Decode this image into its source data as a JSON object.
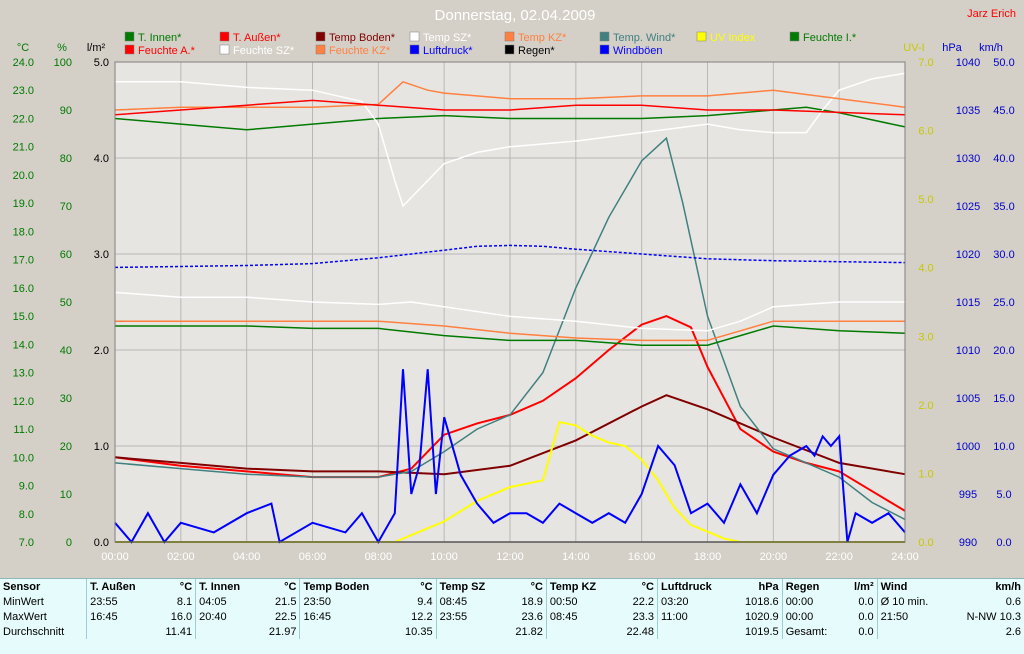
{
  "title": "Donnerstag, 02.04.2009",
  "author": "Jarz Erich",
  "colors": {
    "bg": "#d4d0c8",
    "plot": "#ffffff",
    "grid": "#c8c8c8",
    "green": "#007a00",
    "red": "#ff0000",
    "darkred": "#800000",
    "white": "#ffffff",
    "orange": "#ff8040",
    "blue": "#0000ff",
    "teal": "#408080",
    "yellow": "#ffff00",
    "black": "#000000",
    "rightblue": "#0000cc"
  },
  "legend": [
    {
      "label": "T. Innen*",
      "color": "#007a00"
    },
    {
      "label": "T. Außen*",
      "color": "#ff0000"
    },
    {
      "label": "Temp Boden*",
      "color": "#800000"
    },
    {
      "label": "Temp SZ*",
      "color": "#ffffff"
    },
    {
      "label": "Temp KZ*",
      "color": "#ff8040"
    },
    {
      "label": "Temp. Wind*",
      "color": "#408080"
    },
    {
      "label": "UV Index",
      "color": "#ffff00"
    },
    {
      "label": "Feuchte I.*",
      "color": "#007a00"
    },
    {
      "label": "Feuchte A.*",
      "color": "#ff0000"
    },
    {
      "label": "Feuchte SZ*",
      "color": "#ffffff"
    },
    {
      "label": "Feuchte KZ*",
      "color": "#ff8040"
    },
    {
      "label": "Luftdruck*",
      "color": "#0000ff"
    },
    {
      "label": "Regen*",
      "color": "#000000"
    },
    {
      "label": "Windböen",
      "color": "#0000ff"
    }
  ],
  "axes": {
    "temp": {
      "unit": "°C",
      "min": 7.0,
      "max": 24.0,
      "ticks": [
        "24.0",
        "23.0",
        "22.0",
        "21.0",
        "20.0",
        "19.0",
        "18.0",
        "17.0",
        "16.0",
        "15.0",
        "14.0",
        "13.0",
        "12.0",
        "11.0",
        "10.0",
        "9.0",
        "8.0",
        "7.0"
      ]
    },
    "hum": {
      "unit": "%",
      "min": 0,
      "max": 100,
      "ticks": [
        "100",
        "90",
        "80",
        "70",
        "60",
        "50",
        "40",
        "30",
        "20",
        "10",
        "0"
      ]
    },
    "rain": {
      "unit": "l/m²",
      "min": 0,
      "max": 5,
      "ticks": [
        "5.0",
        "4.0",
        "3.0",
        "2.0",
        "1.0",
        "0.0"
      ]
    },
    "uv": {
      "unit": "UV-I",
      "min": 0,
      "max": 7,
      "ticks": [
        "7.0",
        "6.0",
        "5.0",
        "4.0",
        "3.0",
        "2.0",
        "1.0",
        "0.0"
      ]
    },
    "press": {
      "unit": "hPa",
      "min": 990,
      "max": 1040,
      "ticks": [
        "1040",
        "1035",
        "1030",
        "1025",
        "1020",
        "1015",
        "1010",
        "1005",
        "1000",
        "995",
        "990"
      ]
    },
    "wind": {
      "unit": "km/h",
      "min": 0,
      "max": 50,
      "ticks": [
        "50.0",
        "45.0",
        "40.0",
        "35.0",
        "30.0",
        "25.0",
        "20.0",
        "15.0",
        "10.0",
        "5.0",
        "0.0"
      ]
    },
    "time": {
      "ticks": [
        "00:00",
        "02:00",
        "04:00",
        "06:00",
        "08:00",
        "10:00",
        "12:00",
        "14:00",
        "16:00",
        "18:00",
        "20:00",
        "22:00",
        "24:00"
      ]
    }
  },
  "chart_data": {
    "type": "line",
    "title": "Donnerstag, 02.04.2009",
    "x_unit": "hours",
    "series": [
      {
        "name": "T. Innen*",
        "color": "#007a00",
        "axis": "temp",
        "x": [
          0,
          2,
          4,
          6,
          8,
          10,
          12,
          14,
          16,
          18,
          20,
          21,
          22,
          24
        ],
        "y": [
          22.0,
          21.8,
          21.6,
          21.8,
          22.0,
          22.1,
          22.0,
          22.0,
          22.0,
          22.1,
          22.3,
          22.4,
          22.2,
          21.7
        ]
      },
      {
        "name": "T. Außen*",
        "color": "#ff0000",
        "axis": "temp",
        "x": [
          0,
          2,
          4,
          6,
          8,
          9,
          10,
          11,
          12,
          13,
          14,
          15,
          16,
          16.75,
          17.5,
          18,
          19,
          20,
          21,
          22,
          23,
          24
        ],
        "y": [
          10.0,
          9.7,
          9.5,
          9.3,
          9.3,
          9.6,
          10.8,
          11.2,
          11.5,
          12.0,
          12.8,
          13.8,
          14.7,
          15.0,
          14.6,
          13.2,
          11.0,
          10.2,
          9.8,
          9.5,
          8.8,
          8.1
        ]
      },
      {
        "name": "Temp Boden*",
        "color": "#800000",
        "axis": "temp",
        "x": [
          0,
          2,
          4,
          6,
          8,
          10,
          12,
          14,
          16,
          16.75,
          18,
          20,
          22,
          24
        ],
        "y": [
          10.0,
          9.8,
          9.6,
          9.5,
          9.5,
          9.4,
          9.7,
          10.6,
          11.8,
          12.2,
          11.7,
          10.7,
          9.8,
          9.4
        ]
      },
      {
        "name": "Temp SZ*",
        "color": "#ffffff",
        "axis": "temp",
        "x": [
          0,
          2,
          4,
          6,
          7.5,
          8,
          8.5,
          8.75,
          9.5,
          10,
          11,
          12,
          14,
          16,
          18,
          19,
          20,
          21,
          21.5,
          22,
          23,
          24
        ],
        "y": [
          23.3,
          23.3,
          23.1,
          23.0,
          22.6,
          21.8,
          19.8,
          18.9,
          19.8,
          20.4,
          20.8,
          21.0,
          21.2,
          21.5,
          21.8,
          21.6,
          21.5,
          21.5,
          22.3,
          23.0,
          23.4,
          23.6
        ]
      },
      {
        "name": "Temp KZ*",
        "color": "#ff8040",
        "axis": "temp",
        "x": [
          0,
          2,
          4,
          6,
          8,
          8.75,
          9.5,
          10,
          12,
          14,
          16,
          18,
          20,
          22,
          24
        ],
        "y": [
          22.3,
          22.4,
          22.4,
          22.4,
          22.5,
          23.3,
          23.0,
          22.9,
          22.7,
          22.7,
          22.8,
          22.8,
          23.0,
          22.7,
          22.4
        ]
      },
      {
        "name": "Temp. Wind*",
        "color": "#408080",
        "axis": "temp",
        "x": [
          0,
          2,
          4,
          6,
          8,
          9,
          10,
          11,
          12,
          13,
          14,
          15,
          16,
          16.75,
          17.25,
          18,
          19,
          20,
          21,
          22,
          23,
          24
        ],
        "y": [
          9.8,
          9.6,
          9.4,
          9.3,
          9.3,
          9.5,
          10.2,
          11.0,
          11.5,
          13.0,
          16.0,
          18.5,
          20.5,
          21.3,
          19.0,
          15.0,
          11.8,
          10.3,
          9.8,
          9.3,
          8.4,
          7.8
        ]
      },
      {
        "name": "UV Index",
        "color": "#ffff00",
        "axis": "uv",
        "x": [
          0,
          8.5,
          9,
          10,
          11,
          12,
          13,
          13.5,
          14,
          14.5,
          15,
          15.5,
          16,
          16.5,
          17,
          17.5,
          18,
          18.5,
          19,
          24
        ],
        "y": [
          0,
          0,
          0.1,
          0.3,
          0.6,
          0.8,
          0.9,
          1.75,
          1.7,
          1.55,
          1.45,
          1.4,
          1.2,
          0.9,
          0.5,
          0.25,
          0.15,
          0.05,
          0,
          0
        ]
      },
      {
        "name": "Feuchte I.*",
        "color": "#007a00",
        "axis": "hum",
        "x": [
          0,
          2,
          4,
          6,
          8,
          10,
          12,
          14,
          16,
          18,
          19,
          20,
          22,
          24
        ],
        "y": [
          45,
          45,
          45,
          44.5,
          44.5,
          43,
          42,
          42,
          41,
          41,
          43,
          45,
          44,
          43.5
        ]
      },
      {
        "name": "Feuchte A.*",
        "color": "#ff0000",
        "axis": "hum",
        "x": [
          0,
          2,
          4,
          6,
          8,
          10,
          12,
          14,
          16,
          18,
          20,
          22,
          24
        ],
        "y": [
          89,
          90,
          91,
          92,
          91,
          90,
          90,
          91,
          91,
          90,
          90,
          89.5,
          89
        ]
      },
      {
        "name": "Feuchte SZ*",
        "color": "#ffffff",
        "axis": "hum",
        "x": [
          0,
          2,
          4,
          6,
          8,
          9,
          10,
          12,
          14,
          16,
          18,
          19,
          20,
          22,
          24
        ],
        "y": [
          52,
          51,
          51,
          50,
          49.5,
          50,
          49,
          47,
          46,
          44.5,
          44,
          46,
          49,
          50,
          50
        ]
      },
      {
        "name": "Feuchte KZ*",
        "color": "#ff8040",
        "axis": "hum",
        "x": [
          0,
          2,
          4,
          6,
          8,
          10,
          12,
          14,
          16,
          18,
          19,
          20,
          22,
          24
        ],
        "y": [
          46,
          46,
          46,
          46,
          46,
          45,
          43.5,
          42.5,
          42,
          42,
          44,
          46,
          46,
          46
        ]
      },
      {
        "name": "Luftdruck*",
        "color": "#0000ff",
        "axis": "press",
        "x": [
          0,
          2,
          4,
          6,
          8,
          10,
          11,
          12,
          13,
          14,
          16,
          18,
          20,
          22,
          24
        ],
        "y": [
          1018.6,
          1018.7,
          1018.8,
          1019.0,
          1019.6,
          1020.4,
          1020.8,
          1020.9,
          1020.8,
          1020.5,
          1020.0,
          1019.5,
          1019.3,
          1019.2,
          1019.1
        ]
      },
      {
        "name": "Windböen",
        "color": "#0000ff",
        "axis": "wind",
        "x": [
          0,
          0.5,
          1,
          1.5,
          2,
          3,
          4,
          4.75,
          5,
          6,
          7,
          7.5,
          8,
          8.5,
          8.75,
          9,
          9.25,
          9.5,
          9.75,
          10,
          10.5,
          11,
          11.5,
          12,
          12.5,
          13,
          13.5,
          14,
          14.5,
          15,
          15.5,
          16,
          16.5,
          17,
          17.5,
          18,
          18.5,
          19,
          19.5,
          20,
          20.5,
          21,
          21.25,
          21.5,
          21.75,
          22,
          22.25,
          22.5,
          23,
          23.5,
          24
        ],
        "y": [
          2,
          0,
          3,
          0,
          2,
          1,
          3,
          4,
          0,
          2,
          1,
          3,
          0,
          3,
          18,
          5,
          8,
          18,
          5,
          13,
          7,
          4,
          2,
          3,
          3,
          2,
          4,
          3,
          2,
          3,
          2,
          5,
          10,
          8,
          3,
          4,
          2,
          6,
          3,
          7,
          9,
          10,
          9,
          11,
          10,
          11,
          0,
          3,
          2,
          3,
          1
        ]
      },
      {
        "name": "Regen*",
        "color": "#000000",
        "axis": "rain",
        "x": [
          0,
          24
        ],
        "y": [
          0,
          0
        ]
      }
    ]
  },
  "stats": {
    "headers": [
      "Sensor",
      "T. Außen",
      "°C",
      "T. Innen",
      "°C",
      "Temp Boden",
      "°C",
      "Temp SZ",
      "°C",
      "Temp KZ",
      "°C",
      "Luftdruck",
      "hPa",
      "Regen",
      "l/m²",
      "Wind",
      "km/h"
    ],
    "rows": [
      [
        "MinWert",
        "23:55",
        "8.1",
        "04:05",
        "21.5",
        "23:50",
        "9.4",
        "08:45",
        "18.9",
        "00:50",
        "22.2",
        "03:20",
        "1018.6",
        "00:00",
        "0.0",
        "Ø 10 min.",
        "0.6"
      ],
      [
        "MaxWert",
        "16:45",
        "16.0",
        "20:40",
        "22.5",
        "16:45",
        "12.2",
        "23:55",
        "23.6",
        "08:45",
        "23.3",
        "11:00",
        "1020.9",
        "00:00",
        "0.0",
        "21:50",
        "N-NW 10.3"
      ],
      [
        "Durchschnitt",
        "",
        "11.41",
        "",
        "21.97",
        "",
        "10.35",
        "",
        "21.82",
        "",
        "22.48",
        "",
        "1019.5",
        "Gesamt:",
        "0.0",
        "",
        "2.6"
      ]
    ]
  }
}
